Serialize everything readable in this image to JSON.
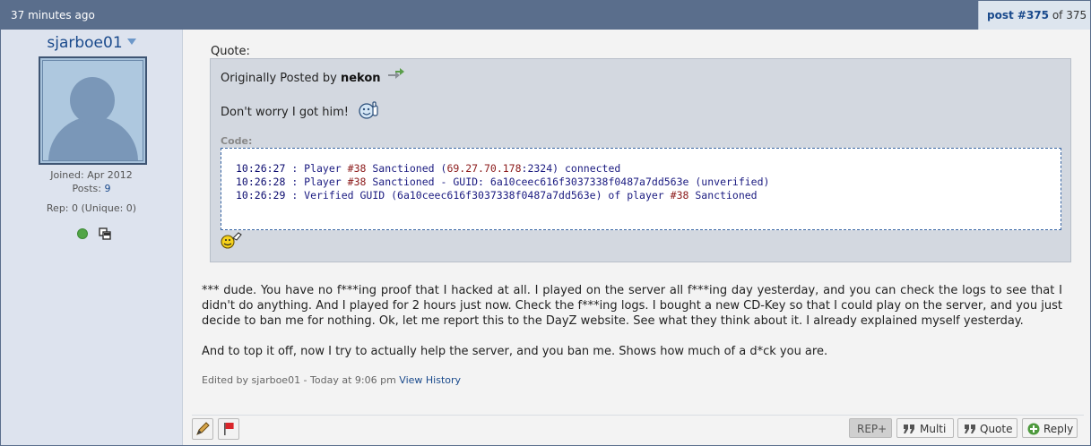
{
  "header": {
    "time_ago": "37 minutes ago",
    "post_link": "post #375",
    "post_of": " of 375"
  },
  "user": {
    "username": "sjarboe01",
    "joined": "Joined: Apr 2012",
    "posts_label": "Posts: ",
    "posts_count": "9",
    "rep": "Rep: 0 (Unique: 0)"
  },
  "quote": {
    "label": "Quote:",
    "originally_posted_by": "Originally Posted by ",
    "author": "nekon",
    "text": "Don't worry I got him!",
    "code_label": "Code:",
    "code_lines": [
      {
        "time": "10:26:27",
        "a": " : Player ",
        "num": "#38",
        "b": " Sanctioned (",
        "ip": "69.27.70.178",
        "c": ":2324) connected"
      },
      {
        "time": "10:26:28",
        "a": " : Player ",
        "num": "#38",
        "b": " Sanctioned - GUID: 6a10ceec616f3037338f0487a7dd563e (unverified)"
      },
      {
        "time": "10:26:29",
        "a": " : Verified GUID (6a10ceec616f3037338f0487a7dd563e) of player ",
        "num": "#38",
        "b": " Sanctioned"
      }
    ]
  },
  "message": {
    "paragraph1": "*** dude. You have no f***ing proof that I hacked at all. I played on the server all f***ing day yesterday, and you can check the logs to see that I didn't do anything. And I played for 2 hours just now. Check the f***ing logs. I bought a new CD-Key so that I could play on the server, and you just decide to ban me for nothing. Ok, let me report this to the DayZ website. See what they think about it. I already explained myself yesterday.",
    "paragraph2": "And to top it off, now I try to actually help the server, and you ban me. Shows how much of a d*ck you are.",
    "edited": "Edited by sjarboe01 - Today at 9:06 pm ",
    "view_history": "View History"
  },
  "footer": {
    "rep_label": "REP+",
    "multi_label": "Multi",
    "quote_label": "Quote",
    "reply_label": "Reply"
  },
  "colors": {
    "header": "#5a6e8c",
    "link": "#1a4a8c",
    "code_border": "#3a67a5",
    "online": "#51a546",
    "report": "#d9262b"
  }
}
